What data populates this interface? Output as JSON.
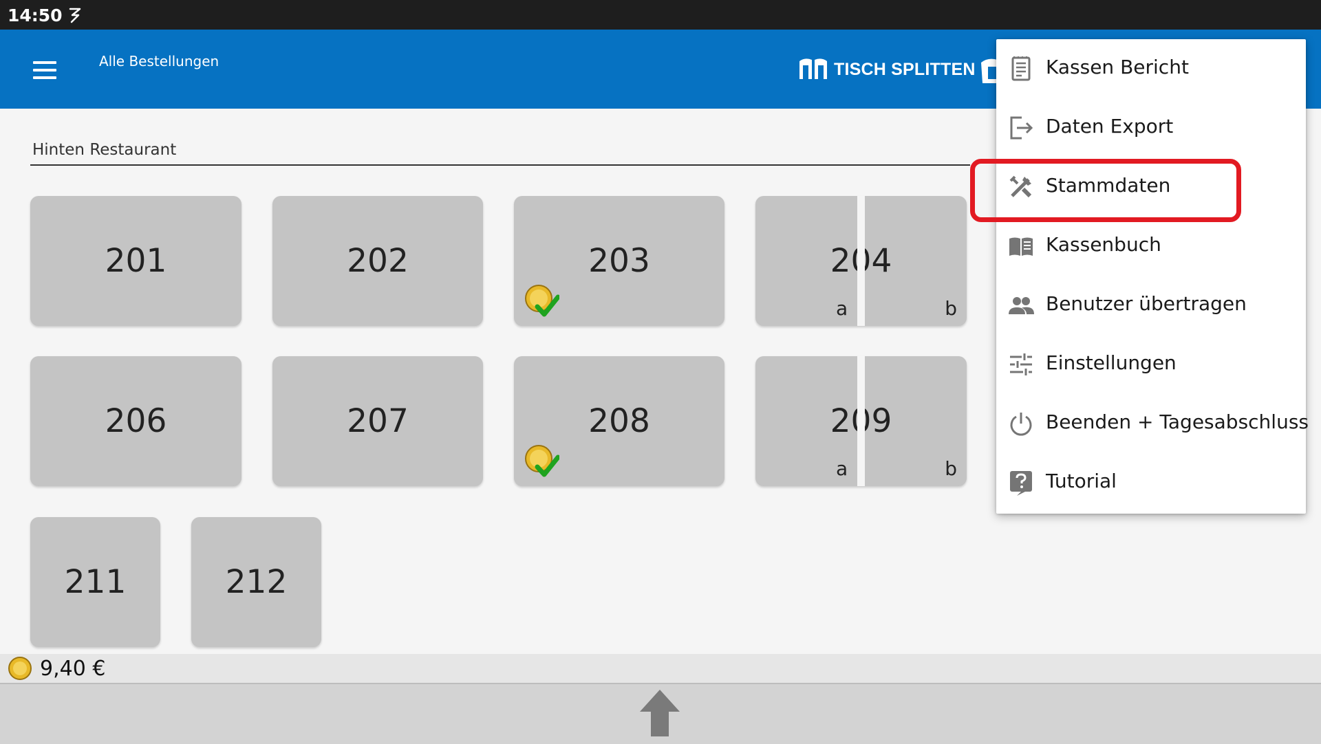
{
  "status_bar": {
    "time": "14:50",
    "icons": [
      "notification-icon"
    ]
  },
  "app_bar": {
    "title": "Alle Bestellungen",
    "actions": [
      {
        "label": "TISCH SPLITTEN",
        "icon": "split-table-icon"
      },
      {
        "label": "",
        "icon": "table-action-icon"
      }
    ]
  },
  "area": {
    "selected": "Hinten Restaurant"
  },
  "tables": [
    {
      "number": "201",
      "paid": false,
      "split": false
    },
    {
      "number": "202",
      "paid": false,
      "split": false
    },
    {
      "number": "203",
      "paid": true,
      "split": false
    },
    {
      "number": "204",
      "paid": false,
      "split": true,
      "sub_a": "a",
      "sub_b": "b"
    },
    {
      "number": "206",
      "paid": false,
      "split": false
    },
    {
      "number": "207",
      "paid": false,
      "split": false
    },
    {
      "number": "208",
      "paid": true,
      "split": false
    },
    {
      "number": "209",
      "paid": false,
      "split": true,
      "sub_a": "a",
      "sub_b": "b"
    },
    {
      "number": "211",
      "paid": false,
      "split": false
    },
    {
      "number": "212",
      "paid": false,
      "split": false
    }
  ],
  "total": {
    "amount": "9,40 €"
  },
  "overflow_menu": {
    "items": [
      {
        "label": "Kassen Bericht",
        "icon": "report-icon"
      },
      {
        "label": "Daten Export",
        "icon": "export-icon"
      },
      {
        "label": "Stammdaten",
        "icon": "tools-icon",
        "highlighted": true
      },
      {
        "label": "Kassenbuch",
        "icon": "book-icon"
      },
      {
        "label": "Benutzer übertragen",
        "icon": "users-icon"
      },
      {
        "label": "Einstellungen",
        "icon": "sliders-icon"
      },
      {
        "label": "Beenden + Tagesabschluss",
        "icon": "power-icon"
      },
      {
        "label": "Tutorial",
        "icon": "help-icon"
      }
    ]
  },
  "colors": {
    "app_bar": "#0672c2",
    "status_bar": "#1e1e1e",
    "tile": "#c4c4c4",
    "highlight": "#e21a22"
  }
}
